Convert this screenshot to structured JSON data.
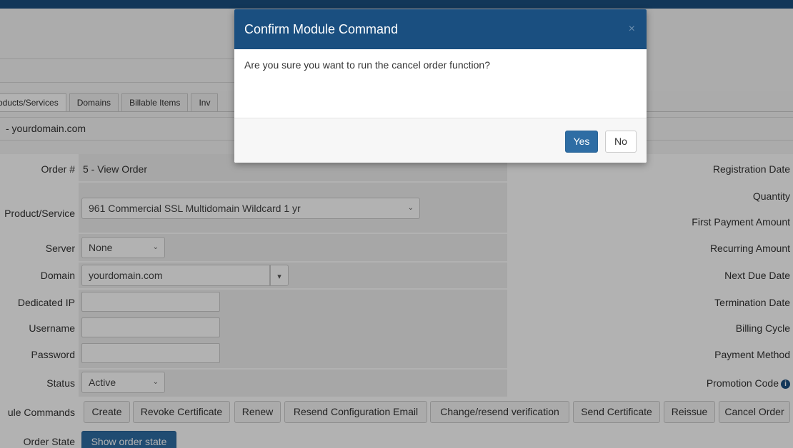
{
  "tabs": [
    "oducts/Services",
    "Domains",
    "Billable Items",
    "Inv"
  ],
  "domain_header": "- yourdomain.com",
  "left_fields": {
    "order_label": "Order #",
    "order_value": "5 - View Order",
    "product_label": "Product/Service",
    "product_value": "961 Commercial SSL Multidomain Wildcard 1 yr",
    "server_label": "Server",
    "server_value": "None",
    "domain_label": "Domain",
    "domain_value": "yourdomain.com",
    "dedicated_ip_label": "Dedicated IP",
    "dedicated_ip_value": "",
    "username_label": "Username",
    "username_value": "",
    "password_label": "Password",
    "password_value": "",
    "status_label": "Status",
    "status_value": "Active",
    "module_commands_label": "ule Commands",
    "order_state_label": "Order State"
  },
  "right_labels": {
    "registration_date": "Registration Date",
    "quantity": "Quantity",
    "first_payment": "First Payment Amount",
    "recurring": "Recurring Amount",
    "next_due": "Next Due Date",
    "termination": "Termination Date",
    "billing_cycle": "Billing Cycle",
    "payment_method": "Payment Method",
    "promotion_code": "Promotion Code"
  },
  "module_buttons": {
    "create": "Create",
    "revoke": "Revoke Certificate",
    "renew": "Renew",
    "resend_config": "Resend Configuration Email",
    "change_verification": "Change/resend verification",
    "send_cert": "Send Certificate",
    "reissue": "Reissue",
    "cancel_order": "Cancel Order"
  },
  "order_state_button": "Show order state",
  "modal": {
    "title": "Confirm Module Command",
    "close": "×",
    "message": "Are you sure you want to run the cancel order function?",
    "yes": "Yes",
    "no": "No"
  },
  "icons": {
    "info": "i",
    "chevron": "⌄",
    "caret": "▾"
  },
  "colors": {
    "header_blue": "#1a4f80",
    "button_blue": "#2e6da4"
  }
}
